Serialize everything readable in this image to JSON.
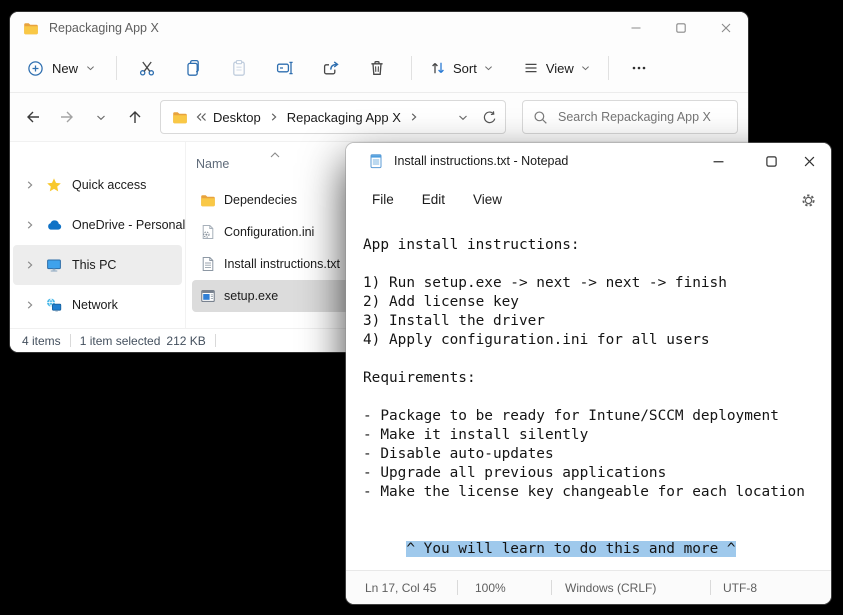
{
  "colors": {
    "desktop_bg": "#000000",
    "accent_blue": "#2b7bd4",
    "folder_yellow": "#f9c846",
    "selection_blue": "#9fc9ec"
  },
  "explorer": {
    "title": "Repackaging App X",
    "toolbar": {
      "new_label": "New",
      "cut": "cut",
      "copy": "copy",
      "paste": "paste",
      "rename": "rename",
      "share": "share",
      "delete": "delete",
      "sort_label": "Sort",
      "view_label": "View",
      "more_label": "more"
    },
    "breadcrumb": [
      "Desktop",
      "Repackaging App X"
    ],
    "search_placeholder": "Search Repackaging App X",
    "sidebar": [
      {
        "label": "Quick access",
        "icon": "star-icon",
        "selected": false
      },
      {
        "label": "OneDrive - Personal",
        "icon": "cloud-icon",
        "selected": false
      },
      {
        "label": "This PC",
        "icon": "monitor-icon",
        "selected": true
      },
      {
        "label": "Network",
        "icon": "network-icon",
        "selected": false
      }
    ],
    "files": {
      "header": "Name",
      "rows": [
        {
          "name": "Dependecies",
          "icon": "folder-icon",
          "selected": false
        },
        {
          "name": "Configuration.ini",
          "icon": "ini-file-icon",
          "selected": false
        },
        {
          "name": "Install instructions.txt",
          "icon": "text-file-icon",
          "selected": false
        },
        {
          "name": "setup.exe",
          "icon": "exe-file-icon",
          "selected": true
        }
      ]
    },
    "status": {
      "count": "4 items",
      "selected": "1 item selected",
      "size": "212 KB"
    }
  },
  "notepad": {
    "title": "Install instructions.txt - Notepad",
    "menu": [
      "File",
      "Edit",
      "View"
    ],
    "body_text": "App install instructions:\n\n1) Run setup.exe -> next -> next -> finish\n2) Add license key\n3) Install the driver\n4) Apply configuration.ini for all users\n\nRequirements:\n\n- Package to be ready for Intune/SCCM deployment\n- Make it install silently\n- Disable auto-updates\n- Upgrade all previous applications\n- Make the license key changeable for each location",
    "selected_line": {
      "prefix": "     ",
      "text": "^ You will learn to do this and more ^"
    },
    "status": {
      "position": "Ln 17, Col 45",
      "zoom": "100%",
      "eol": "Windows (CRLF)",
      "encoding": "UTF-8"
    }
  }
}
